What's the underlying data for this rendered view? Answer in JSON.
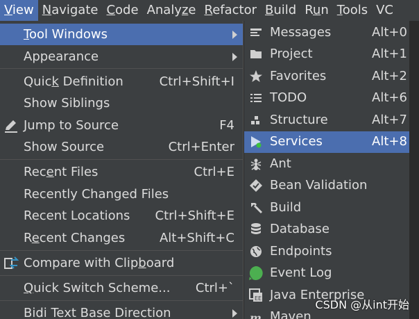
{
  "menubar": {
    "items": [
      {
        "pre": "",
        "u": "V",
        "post": "iew"
      },
      {
        "pre": "",
        "u": "N",
        "post": "avigate"
      },
      {
        "pre": "",
        "u": "C",
        "post": "ode"
      },
      {
        "pre": "Analy",
        "u": "z",
        "post": "e"
      },
      {
        "pre": "",
        "u": "R",
        "post": "efactor"
      },
      {
        "pre": "",
        "u": "B",
        "post": "uild"
      },
      {
        "pre": "R",
        "u": "u",
        "post": "n"
      },
      {
        "pre": "",
        "u": "T",
        "post": "ools"
      },
      {
        "pre": "VC",
        "u": "",
        "post": ""
      }
    ]
  },
  "view_menu": {
    "tool_windows": {
      "u": "T",
      "post": "ool Windows"
    },
    "appearance": "Appearance",
    "quick_definition": {
      "pre": "Quic",
      "u": "k",
      "post": " Definition",
      "shortcut": "Ctrl+Shift+I"
    },
    "show_siblings": "Show Siblings",
    "jump_to_source": {
      "label": "Jump to Source",
      "shortcut": "F4"
    },
    "show_source": {
      "label": "Show Source",
      "shortcut": "Ctrl+Enter"
    },
    "recent_files": {
      "pre": "Rec",
      "u": "e",
      "post": "nt Files",
      "shortcut": "Ctrl+E"
    },
    "recently_changed_files": "Recently Changed Files",
    "recent_locations": {
      "label": "Recent Locations",
      "shortcut": "Ctrl+Shift+E"
    },
    "recent_changes": {
      "pre": "R",
      "u": "e",
      "post": "cent Changes",
      "shortcut": "Alt+Shift+C"
    },
    "compare_clipboard": {
      "pre": "Compare with Clip",
      "u": "b",
      "post": "oard"
    },
    "quick_switch": {
      "pre": "",
      "u": "Q",
      "post": "uick Switch Scheme...",
      "shortcut": "Ctrl+`"
    },
    "bidi": "Bidi Text Base Direction"
  },
  "tool_windows_menu": {
    "items": [
      {
        "label": "Messages",
        "shortcut": "Alt+0"
      },
      {
        "label": "Project",
        "shortcut": "Alt+1"
      },
      {
        "label": "Favorites",
        "shortcut": "Alt+2"
      },
      {
        "label": "TODO",
        "shortcut": "Alt+6"
      },
      {
        "label": "Structure",
        "shortcut": "Alt+7"
      },
      {
        "label": "Services",
        "shortcut": "Alt+8"
      },
      {
        "label": "Ant",
        "shortcut": ""
      },
      {
        "label": "Bean Validation",
        "shortcut": ""
      },
      {
        "label": "Build",
        "shortcut": ""
      },
      {
        "label": "Database",
        "shortcut": ""
      },
      {
        "label": "Endpoints",
        "shortcut": ""
      },
      {
        "label": "Event Log",
        "shortcut": ""
      },
      {
        "label": "Java Enterprise",
        "shortcut": ""
      },
      {
        "label": "Maven",
        "shortcut": ""
      }
    ]
  },
  "colors": {
    "selection": "#4b6eaf",
    "background": "#3c3f41",
    "event_log_green": "#4caf50",
    "services_green": "#3dc13d"
  },
  "watermark": "CSDN @从int开始"
}
